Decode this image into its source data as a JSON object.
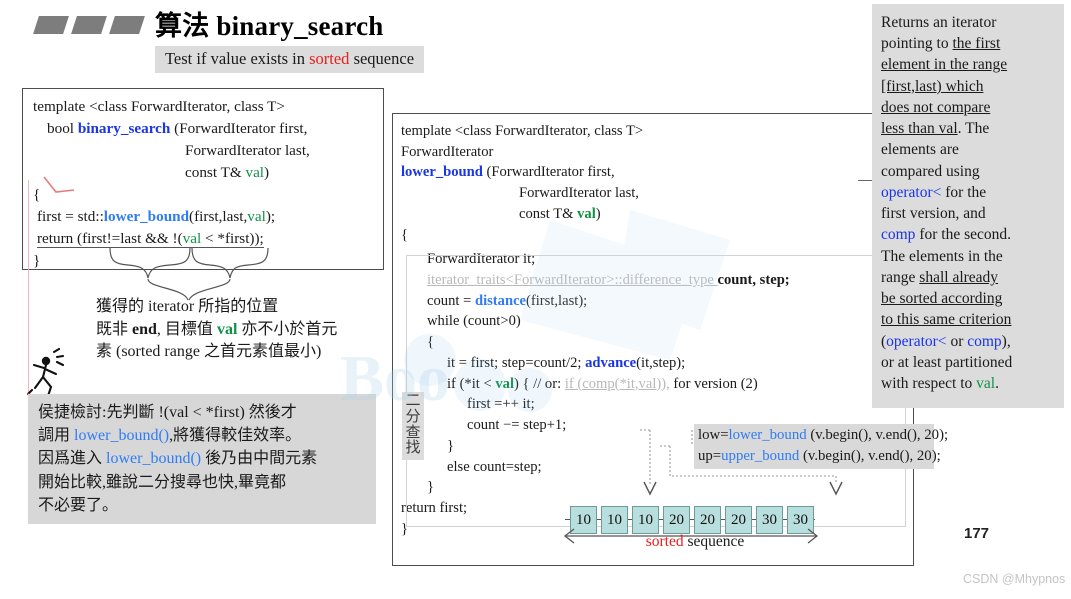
{
  "header": {
    "title_cn": "算法",
    "title_code": "binary_search",
    "subtitle_pre": "Test if value exists in ",
    "subtitle_em": "sorted",
    "subtitle_post": " sequence"
  },
  "left_code": {
    "lines": [
      "template <class ForwardIterator, class T>",
      "bool binary_search (ForwardIterator first,",
      "ForwardIterator last,",
      "const T& val)",
      "{",
      "first = std::lower_bound(first,last,val);",
      "return (first!=last && !(val < *first));",
      "}"
    ],
    "l0": "template <class ForwardIterator, class T>",
    "l1_a": "bool ",
    "l1_fn": "binary_search",
    "l1_b": " (ForwardIterator first,",
    "l2": "ForwardIterator last,",
    "l3_a": "const T& ",
    "l3_val": "val",
    "l3_b": ")",
    "l4": "{",
    "l5_a": "first = std::",
    "l5_fn": "lower_bound",
    "l5_b": "(first,last,",
    "l5_val": "val",
    "l5_c": ");",
    "l6_a": "return (first!=last && !(",
    "l6_val": "val",
    "l6_b": " < *first));",
    "l7": "}"
  },
  "note_plain": {
    "line1": "獲得的 iterator 所指的位置",
    "line2_a": "既非 ",
    "line2_end": "end",
    "line2_b": ", 目標值 ",
    "line2_val": "val",
    "line2_c": " 亦不小於首元",
    "line3": "素 (sorted range 之首元素值最小)"
  },
  "callout": {
    "l1": "侯捷檢討:先判斷 !(val < *first) 然後才",
    "l1_a": "侯捷檢討:先判斷 !(val < *first) 然後才",
    "l2_a": "調用 ",
    "l2_fn": "lower_bound()",
    "l2_b": ",將獲得較佳效率。",
    "l3_a": "因爲進入 ",
    "l3_fn": "lower_bound()",
    "l3_b": " 後乃由中間元素",
    "l4": "開始比較,雖說二分搜尋也快,畢竟都",
    "l5": "不必要了。"
  },
  "mid_code": {
    "l0": "template <class ForwardIterator, class T>",
    "l1": "ForwardIterator",
    "l2_fn": "lower_bound",
    "l2_b": " (ForwardIterator first,",
    "l3": "ForwardIterator last,",
    "l4_a": "const T& ",
    "l4_val": "val",
    "l4_b": ")",
    "l5": "{",
    "l6": "ForwardIterator it;",
    "l7_faint": "iterator_traits<ForwardIterator>::difference_type ",
    "l7_bold": "count, step;",
    "l8_a": "count = ",
    "l8_fn": "distance",
    "l8_b": "(first,last);",
    "l9": "while (count>0)",
    "l10": "{",
    "l11_a": "it = first; step=count/2; ",
    "l11_fn": "advance",
    "l11_b": "(it,step);",
    "l12_a": "if (*it < ",
    "l12_val": "val",
    "l12_b": ") {   // or: ",
    "l12_faint": "if (comp(*it,val)),",
    "l12_c": " for version (2)",
    "l13": "first =++ it;",
    "l14": "count −= step+1;",
    "l15": "}",
    "l16": "else count=step;",
    "l17": "}",
    "l18": "return first;",
    "l19": "}"
  },
  "vertical_label": [
    "二",
    "分",
    "查",
    "找"
  ],
  "sequence": {
    "values": [
      "10",
      "10",
      "10",
      "20",
      "20",
      "20",
      "30",
      "30"
    ],
    "label_em": "sorted",
    "label_rest": " sequence"
  },
  "lowup": {
    "low_var": "low=",
    "low_fn": "lower_bound",
    "low_args": " (v.begin(), v.end(), 20);",
    "up_var": "up=",
    "up_fn": "upper_bound",
    "up_args": " (v.begin(), v.end(), 20);"
  },
  "description": {
    "lines": [
      "Returns an iterator",
      "pointing to the first",
      "element in the range",
      "[first,last) which",
      "does not compare",
      "less than val. The",
      "elements are",
      "compared using",
      "operator< for the",
      "first version, and",
      "comp for the second.",
      "The elements in the",
      "range shall already",
      "be sorted according",
      "to this same criterion",
      "(operator< or comp),",
      "or at least partitioned",
      "with respect to val."
    ],
    "l0": "Returns an iterator",
    "l1_a": "pointing to ",
    "l1_u": "the first",
    "l2_u": "element in the range",
    "l3_u": "[first,last) which",
    "l4_u": "does not compare",
    "l5_u": "less than val",
    "l5_b": ". The",
    "l6": "elements are",
    "l7": "compared using",
    "l8_fn": "operator<",
    "l8_b": " for the",
    "l9": "first version, and",
    "l10_fn": "comp",
    "l10_b": " for the second.",
    "l11": "The elements in the",
    "l12_a": "range ",
    "l12_u": "shall already",
    "l13_u": "be sorted according",
    "l14_u": "to this same criterion",
    "l15_a": "(",
    "l15_fn1": "operator<",
    "l15_m": " or ",
    "l15_fn2": "comp",
    "l15_b": "),",
    "l16": "or at least partitioned",
    "l17_a": "with respect to ",
    "l17_val": "val",
    "l17_b": "."
  },
  "footer": {
    "page_number": "177",
    "watermark": "CSDN @Mhypnos"
  },
  "colors": {
    "accent_blue": "#1a34e8",
    "link_blue": "#2f7cf6",
    "green": "#0f9246",
    "red": "#e8201f",
    "cell_fill": "#b9dede",
    "grey_panel": "#dcdcdc"
  }
}
